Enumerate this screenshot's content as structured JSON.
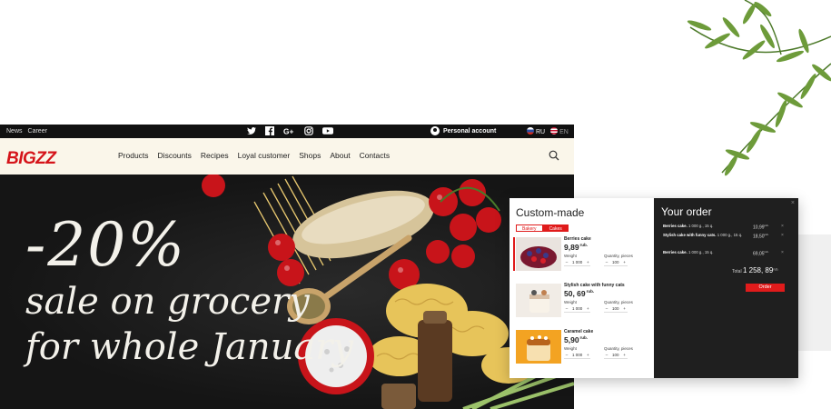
{
  "topbar": {
    "links": [
      "News",
      "Career"
    ],
    "social_icons": [
      "twitter-icon",
      "facebook-icon",
      "google-plus-icon",
      "instagram-icon",
      "youtube-icon"
    ],
    "account_label": "Personal account",
    "languages": [
      {
        "code": "RU",
        "active": true
      },
      {
        "code": "EN",
        "active": false
      }
    ]
  },
  "navbar": {
    "logo": "BIGZZ",
    "menu": [
      "Products",
      "Discounts",
      "Recipes",
      "Loyal customer",
      "Shops",
      "About",
      "Contacts"
    ]
  },
  "hero": {
    "discount": "-20%",
    "line1": "sale on grocery",
    "line2": "for whole January"
  },
  "custom_made": {
    "title": "Custom-made",
    "tabs": [
      {
        "label": "Bakery",
        "active": false
      },
      {
        "label": "Cakes",
        "active": true
      }
    ],
    "weight_label": "Weight",
    "quantity_label": "Quantity, pieces",
    "products": [
      {
        "name": "Berries cake",
        "price": "9,89",
        "currency": "rub.",
        "weight": "1 000",
        "quantity": "100"
      },
      {
        "name": "Stylish cake with funny cats",
        "price": "50, 69",
        "currency": "rub.",
        "weight": "1 000",
        "quantity": "100"
      },
      {
        "name": "Caramel cake",
        "price": "5,90",
        "currency": "rub.",
        "weight": "1 000",
        "quantity": "100"
      }
    ]
  },
  "your_order": {
    "title": "Your order",
    "items": [
      {
        "name": "Berries cake.",
        "detail": "1 000 g., 15 q.",
        "amount": "10,99",
        "currency": "rub."
      },
      {
        "name": "Stylish cake with funny cats.",
        "detail": "1 000 g., 15 q.",
        "amount": "18,50",
        "currency": "rub."
      },
      {
        "name": "Berries cake.",
        "detail": "1 000 g., 15 q.",
        "amount": "69,05",
        "currency": "rub."
      }
    ],
    "total_label": "Total",
    "total_value": "1 258, 89",
    "total_currency": "rub.",
    "order_button": "Order"
  },
  "colors": {
    "accent": "#e01b1b",
    "dark": "#1f1f1f",
    "nav_bg": "#faf6ea"
  }
}
